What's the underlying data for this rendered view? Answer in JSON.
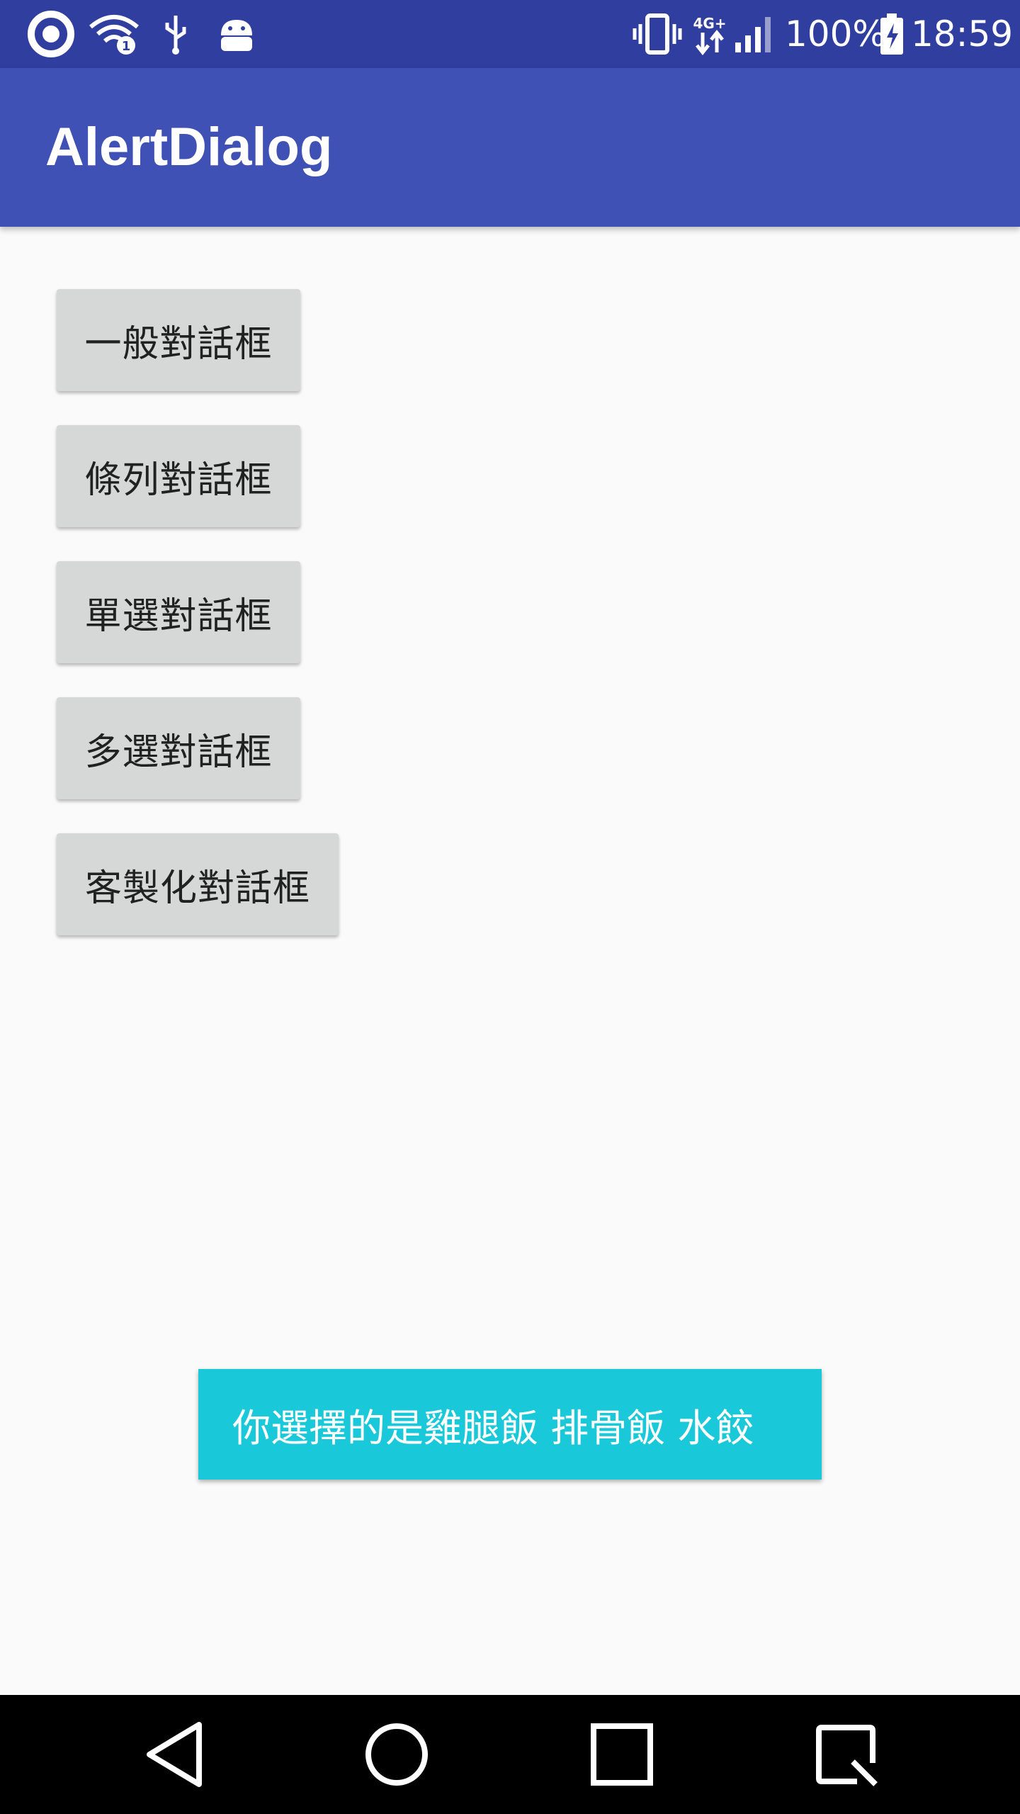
{
  "status_bar": {
    "battery_percent": "100%",
    "time": "18:59",
    "network": "4G+",
    "icons": [
      "opera-icon",
      "wifi-icon",
      "usb-icon",
      "android-debug-icon",
      "vibrate-icon",
      "network-4g-icon",
      "signal-icon",
      "battery-charging-icon"
    ]
  },
  "app_bar": {
    "title": "AlertDialog"
  },
  "buttons": [
    {
      "label": "一般對話框"
    },
    {
      "label": "條列對話框"
    },
    {
      "label": "單選對話框"
    },
    {
      "label": "多選對話框"
    },
    {
      "label": "客製化對話框"
    }
  ],
  "toast": {
    "message": "你選擇的是雞腿飯 排骨飯 水餃"
  },
  "nav_bar": {
    "icons": [
      "back-icon",
      "home-icon",
      "recents-icon",
      "screenshot-icon"
    ]
  },
  "colors": {
    "status_bar": "#303f9f",
    "app_bar": "#3f51b5",
    "button": "#d6d7d7",
    "toast": "#1ac9d9",
    "background": "#fafafa"
  }
}
